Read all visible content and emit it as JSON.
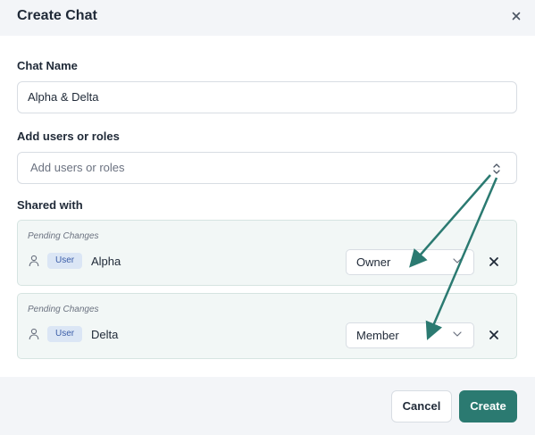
{
  "dialog": {
    "title": "Create Chat",
    "close_icon": "close-icon"
  },
  "chat_name": {
    "label": "Chat Name",
    "value": "Alpha & Delta"
  },
  "add_users": {
    "label": "Add users or roles",
    "placeholder": "Add users or roles",
    "icon": "chevron-up-down-icon"
  },
  "shared_with": {
    "label": "Shared with",
    "entries": [
      {
        "status": "Pending Changes",
        "type": "User",
        "name": "Alpha",
        "role": "Owner"
      },
      {
        "status": "Pending Changes",
        "type": "User",
        "name": "Delta",
        "role": "Member"
      }
    ]
  },
  "footer": {
    "cancel_label": "Cancel",
    "create_label": "Create"
  },
  "colors": {
    "accent": "#2b7a71",
    "annotation_arrow": "#2b7a71",
    "badge_bg": "#dbe6f5",
    "card_bg": "#f2f7f6"
  }
}
